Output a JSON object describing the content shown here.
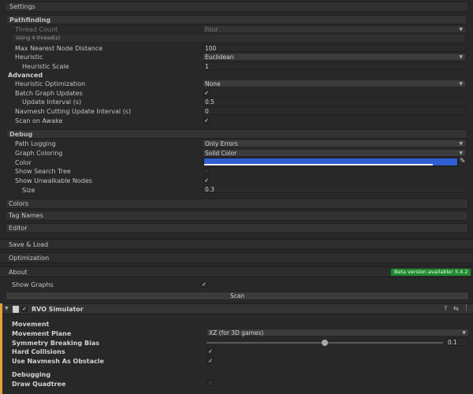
{
  "settings": {
    "title": "Settings",
    "pathfinding": {
      "title": "Pathfinding",
      "thread_count_label": "Thread Count",
      "thread_count_value": "Four",
      "thread_info": "Using 4 thread(s)",
      "max_nearest_label": "Max Nearest Node Distance",
      "max_nearest_value": "100",
      "heuristic_label": "Heuristic",
      "heuristic_value": "Euclidean",
      "heuristic_scale_label": "Heuristic Scale",
      "heuristic_scale_value": "1"
    },
    "advanced": {
      "title": "Advanced",
      "heuristic_opt_label": "Heuristic Optimization",
      "heuristic_opt_value": "None",
      "batch_updates_label": "Batch Graph Updates",
      "update_interval_label": "Update Interval (s)",
      "update_interval_value": "0.5",
      "navmesh_cutting_label": "Navmesh Cutting Update Interval (s)",
      "navmesh_cutting_value": "0",
      "scan_on_awake_label": "Scan on Awake"
    },
    "debug": {
      "title": "Debug",
      "path_logging_label": "Path Logging",
      "path_logging_value": "Only Errors",
      "graph_coloring_label": "Graph Coloring",
      "graph_coloring_value": "Solid Color",
      "color_label": "Color",
      "color_value": "#2f5fd0",
      "show_search_tree_label": "Show Search Tree",
      "show_unwalkable_label": "Show Unwalkable Nodes",
      "size_label": "Size",
      "size_value": "0.3"
    },
    "colors_label": "Colors",
    "tag_names_label": "Tag Names",
    "editor_label": "Editor"
  },
  "save_load_label": "Save & Load",
  "optimization_label": "Optimization",
  "about": {
    "label": "About",
    "beta_badge": "Beta version available! 5.4.2"
  },
  "show_graphs_label": "Show Graphs",
  "scan_button": "Scan",
  "rvo": {
    "title": "RVO Simulator",
    "movement_title": "Movement",
    "movement_plane_label": "Movement Plane",
    "movement_plane_value": "XZ (for 3D games)",
    "symmetry_label": "Symmetry Breaking Bias",
    "symmetry_value": "0.1",
    "hard_collisions_label": "Hard Collisions",
    "navmesh_obstacle_label": "Use Navmesh As Obstacle",
    "debugging_title": "Debugging",
    "draw_quadtree_label": "Draw Quadtree"
  },
  "colors": {
    "accent_orange": "#e3a23a",
    "badge_green": "#1f8a2d"
  }
}
